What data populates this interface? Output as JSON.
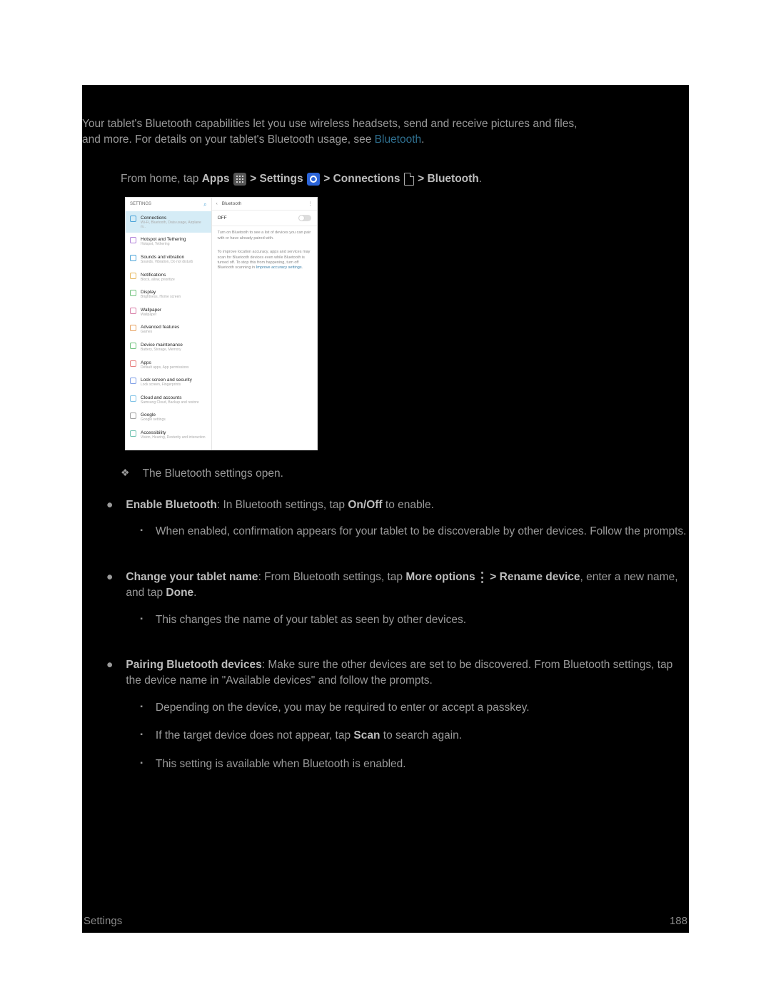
{
  "intro": {
    "line1": "Your tablet's Bluetooth capabilities let you use wireless headsets, send and receive pictures and files,",
    "line2_prefix": "and more. For details on your tablet's Bluetooth usage, see ",
    "link": "Bluetooth",
    "period": "."
  },
  "nav": {
    "prefix": "From home, tap ",
    "apps": "Apps",
    "gt1": " > ",
    "settings": "Settings",
    "gt2": " > ",
    "connections": "Connections",
    "gt3": " > ",
    "bluetooth": "Bluetooth",
    "period": "."
  },
  "screenshot": {
    "left": {
      "title": "SETTINGS",
      "search_glyph": "⌕",
      "items": [
        {
          "title": "Connections",
          "sub": "Wi-Fi, Bluetooth, Data usage, Airplane m..",
          "color": "#4aa3d8",
          "active": true
        },
        {
          "title": "Hotspot and Tethering",
          "sub": "Hotspot, Tethering",
          "color": "#b080d8"
        },
        {
          "title": "Sounds and vibration",
          "sub": "Sounds, Vibration, Do not disturb",
          "color": "#4aa3d8"
        },
        {
          "title": "Notifications",
          "sub": "Block, allow, prioritize",
          "color": "#e6b85e"
        },
        {
          "title": "Display",
          "sub": "Brightness, Home screen",
          "color": "#6fc27d"
        },
        {
          "title": "Wallpaper",
          "sub": "Wallpaper",
          "color": "#d87fa8"
        },
        {
          "title": "Advanced features",
          "sub": "Games",
          "color": "#e6a05e"
        },
        {
          "title": "Device maintenance",
          "sub": "Battery, Storage, Memory",
          "color": "#6fc27d"
        },
        {
          "title": "Apps",
          "sub": "Default apps, App permissions",
          "color": "#e67f7f"
        },
        {
          "title": "Lock screen and security",
          "sub": "Lock screen, Fingerprints",
          "color": "#7f9fe6"
        },
        {
          "title": "Cloud and accounts",
          "sub": "Samsung Cloud, Backup and restore",
          "color": "#7fc2e6"
        },
        {
          "title": "Google",
          "sub": "Google settings",
          "color": "#a0a0a0"
        },
        {
          "title": "Accessibility",
          "sub": "Vision, Hearing, Dexterity and interaction",
          "color": "#6fc2b0"
        }
      ]
    },
    "right": {
      "back_glyph": "‹",
      "title": "Bluetooth",
      "dots_glyph": "⋮",
      "toggle_label": "OFF",
      "para1": "Turn on Bluetooth to see a list of devices you can pair with or have already paired with.",
      "para2_prefix": "To improve location accuracy, apps and services may scan for Bluetooth devices even while Bluetooth is turned off. To stop this from happening, turn off Bluetooth scanning in ",
      "para2_link": "Improve accuracy settings",
      "para2_suffix": "."
    }
  },
  "after_shot": "The Bluetooth settings open.",
  "bullets": {
    "b1_label": "Enable Bluetooth",
    "b1_rest_a": ": In Bluetooth settings, tap ",
    "b1_onoff": "On/Off",
    "b1_rest_b": " to enable.",
    "b1_sub1": "When enabled, confirmation appears for your tablet to be discoverable by other devices. Follow the prompts.",
    "b2_label": "Change your tablet name",
    "b2_rest_a": ": From Bluetooth settings, tap ",
    "b2_more": "More options",
    "b2_gt": " > ",
    "b2_rename": "Rename device",
    "b2_rest_b": ", enter a new name, and tap ",
    "b2_done": "Done",
    "b2_rest_c": ".",
    "b2_sub1": "This changes the name of your tablet as seen by other devices.",
    "b3_label": "Pairing Bluetooth devices",
    "b3_rest": ": Make sure the other devices are set to be discovered. From Bluetooth settings, tap the device name in \"Available devices\" and follow the prompts.",
    "b3_sub1": "Depending on the device, you may be required to enter or accept a passkey.",
    "b3_sub2_a": "If the target device does not appear, tap ",
    "b3_sub2_scan": "Scan",
    "b3_sub2_b": " to search again.",
    "b3_sub3": "This setting is available when Bluetooth is enabled."
  },
  "footer": {
    "left": "Settings",
    "right": "188"
  }
}
